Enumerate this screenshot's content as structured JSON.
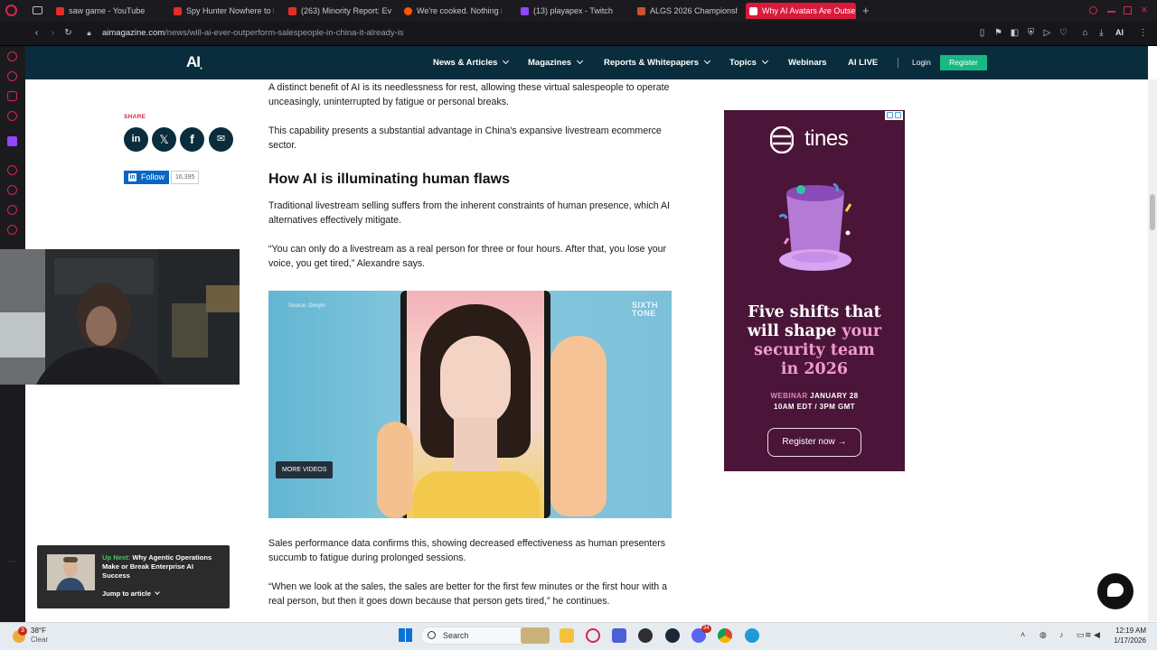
{
  "browser": {
    "tabs": [
      {
        "label": "saw game - YouTube",
        "icon": "youtube-icon",
        "color": "#e52d27"
      },
      {
        "label": "Spy Hunter Nowhere to R",
        "icon": "youtube-icon",
        "color": "#e52d27"
      },
      {
        "label": "(263) Minority Report: Eve",
        "icon": "youtube-icon",
        "color": "#e52d27"
      },
      {
        "label": "We're cooked. Nothing is",
        "icon": "reddit-icon",
        "color": "#ff5700"
      },
      {
        "label": "(13) playapex - Twitch",
        "icon": "twitch-icon",
        "color": "#9146ff"
      },
      {
        "label": "ALGS 2026 Championship",
        "icon": "apex-icon",
        "color": "#c9532c"
      },
      {
        "label": "Why AI Avatars Are Outse",
        "icon": "aimagazine-icon",
        "color": "#ffffff"
      }
    ],
    "url_domain": "aimagazine.com",
    "url_path": "/news/will-ai-ever-outperform-salespeople-in-china-it-already-is",
    "ai_label": "AI"
  },
  "site": {
    "logo": "AI",
    "nav": [
      "News & Articles",
      "Magazines",
      "Reports & Whitepapers",
      "Topics",
      "Webinars",
      "AI LIVE"
    ],
    "login": "Login",
    "register": "Register",
    "brand_color": "#0a2d3d",
    "accent_color": "#17b983"
  },
  "share": {
    "label": "SHARE",
    "follow_label": "Follow",
    "follow_count": "16,395"
  },
  "article": {
    "p1": "A distinct benefit of AI is its needlessness for rest, allowing these virtual salespeople to operate unceasingly, uninterrupted by fatigue or personal breaks.",
    "p2": "This capability presents a substantial advantage in China's expansive livestream ecommerce sector.",
    "heading": "How AI is illuminating human flaws",
    "p3": "Traditional livestream selling suffers from the inherent constraints of human presence, which AI alternatives effectively mitigate.",
    "p4": "“You can only do a livestream as a real person for three or four hours. After that, you lose your voice, you get tired,” Alexandre says.",
    "p5": "Sales performance data confirms this, showing decreased effectiveness as human presenters succumb to fatigue during prolonged sessions.",
    "p6": "“When we look at the sales, the sales are better for the first few minutes or the first hour with a real person, but then it goes down because that person gets tired,” he continues."
  },
  "video": {
    "source": "Source: Douyin",
    "watermark_1": "SIXTH",
    "watermark_2": "TONE",
    "more_videos": "MORE VIDEOS"
  },
  "ad": {
    "brand": "tines",
    "headline_1": "Five shifts that",
    "headline_2a": "will shape ",
    "headline_2b": "your",
    "headline_3": "security team",
    "headline_4": "in 2026",
    "webinar_label": "WEBINAR",
    "webinar_date": "JANUARY 28",
    "webinar_time": "10AM EDT / 3PM GMT",
    "cta": "Register now →"
  },
  "upnext": {
    "label": "Up Next:",
    "title": "Why Agentic Operations Make or Break Enterprise AI Success",
    "jump": "Jump to article"
  },
  "taskbar": {
    "weather_badge": "3",
    "temp": "38°F",
    "condition": "Clear",
    "search": "Search",
    "time": "12:19 AM",
    "date": "1/17/2026",
    "discord_badge": "34"
  }
}
